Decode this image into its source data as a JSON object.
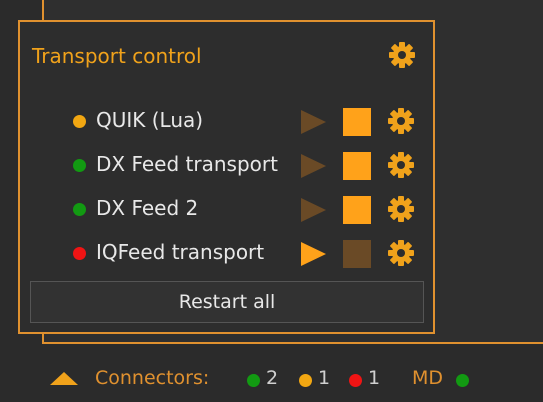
{
  "panel": {
    "title": "Transport control",
    "accent_color": "#f0a21b",
    "restart_label": "Restart all"
  },
  "transports": [
    {
      "label": "QUIK (Lua)",
      "status_color": "#f2a712",
      "play_enabled": false,
      "stop_enabled": true
    },
    {
      "label": "DX Feed transport",
      "status_color": "#129a12",
      "play_enabled": false,
      "stop_enabled": true
    },
    {
      "label": "DX Feed 2",
      "status_color": "#129a12",
      "play_enabled": false,
      "stop_enabled": true
    },
    {
      "label": "IQFeed transport",
      "status_color": "#f01414",
      "play_enabled": true,
      "stop_enabled": false
    }
  ],
  "status_bar": {
    "connectors_label": "Connectors:",
    "green_count": "2",
    "yellow_count": "1",
    "red_count": "1",
    "md_label": "MD",
    "icons": [
      "chevron-up-icon"
    ]
  }
}
